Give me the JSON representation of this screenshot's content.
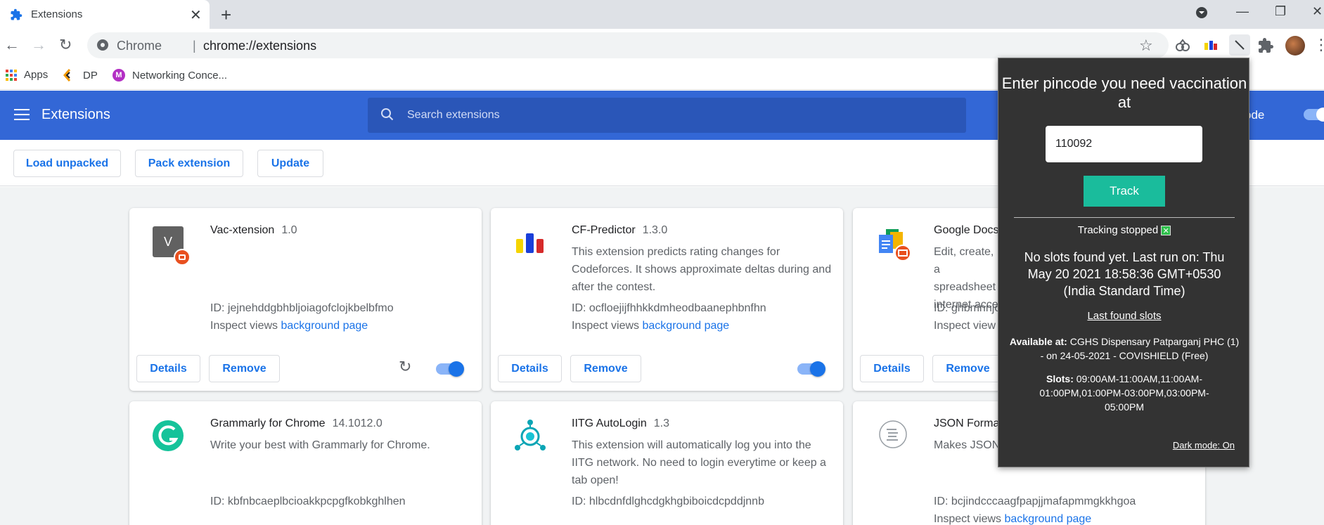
{
  "tab": {
    "title": "Extensions",
    "favicon": "puzzle-icon"
  },
  "omnibox": {
    "scheme": "Chrome",
    "separator": "|",
    "url": "chrome://extensions"
  },
  "bookmarks": [
    {
      "label": "Apps",
      "icon": "apps-grid-icon"
    },
    {
      "label": "DP",
      "icon": "dp-icon"
    },
    {
      "label": "Networking Conce...",
      "icon": "m-avatar-icon"
    }
  ],
  "header": {
    "title": "Extensions",
    "search_placeholder": "Search extensions",
    "dev_mode_label": "er mode"
  },
  "actions": {
    "load_unpacked": "Load unpacked",
    "pack_extension": "Pack extension",
    "update": "Update"
  },
  "cards": [
    {
      "name": "Vac-xtension",
      "version": "1.0",
      "description": "",
      "id": "ID: jejnehddgbhbljoiagofclojkbelbfmo",
      "inspect_prefix": "Inspect views",
      "inspect_link": "background page",
      "details": "Details",
      "remove": "Remove",
      "icon_letter": "V",
      "enabled": true
    },
    {
      "name": "CF-Predictor",
      "version": "1.3.0",
      "description": "This extension predicts rating changes for Codeforces. It shows approximate deltas during and after the contest.",
      "id": "ID: ocfloejijfhhkkdmheodbaanephbnfhn",
      "inspect_prefix": "Inspect views",
      "inspect_link": "background page",
      "details": "Details",
      "remove": "Remove",
      "enabled": true
    },
    {
      "name": "Google Docs",
      "version": "",
      "description": "Edit, create, a spreadsheet internet acce",
      "id": "ID: ghbmnnjo",
      "inspect_prefix": "Inspect view",
      "inspect_link": "",
      "details": "Details",
      "remove": "Remove",
      "enabled": true
    },
    {
      "name": "Grammarly for Chrome",
      "version": "14.1012.0",
      "description": "Write your best with Grammarly for Chrome.",
      "id": "ID: kbfnbcaeplbcioakkpcpgfkobkghlhen"
    },
    {
      "name": "IITG AutoLogin",
      "version": "1.3",
      "description": "This extension will automatically log you into the IITG network. No need to login everytime or keep a tab open!",
      "id": "ID: hlbcdnfdlghcdgkhgbiboicdcpddjnnb"
    },
    {
      "name": "JSON Forma",
      "version": "",
      "description": "Makes JSON",
      "id": "ID: bcjindcccaagfpapjjmafapmmgkkhgoa",
      "inspect_prefix": "Inspect views",
      "inspect_link": "background page"
    }
  ],
  "popup": {
    "heading": "Enter pincode you need vaccination at",
    "pincode": "110092",
    "track": "Track",
    "status": "Tracking stopped",
    "status_mark": "✕",
    "last_run": "No slots found yet. Last run on: Thu May 20 2021 18:58:36 GMT+0530 (India Standard Time)",
    "last_found": "Last found slots",
    "available_label": "Available at:",
    "available_value": "CGHS Dispensary Patparganj PHC (1) - on 24-05-2021 - COVISHIELD (Free)",
    "slots_label": "Slots:",
    "slots_value": "09:00AM-11:00AM,11:00AM-01:00PM,01:00PM-03:00PM,03:00PM-05:00PM",
    "dark_mode": "Dark mode: On"
  },
  "colors": {
    "accent": "#1a73e8",
    "header": "#3367d6",
    "popup_bg": "#333333",
    "track_btn": "#1abc9c"
  }
}
